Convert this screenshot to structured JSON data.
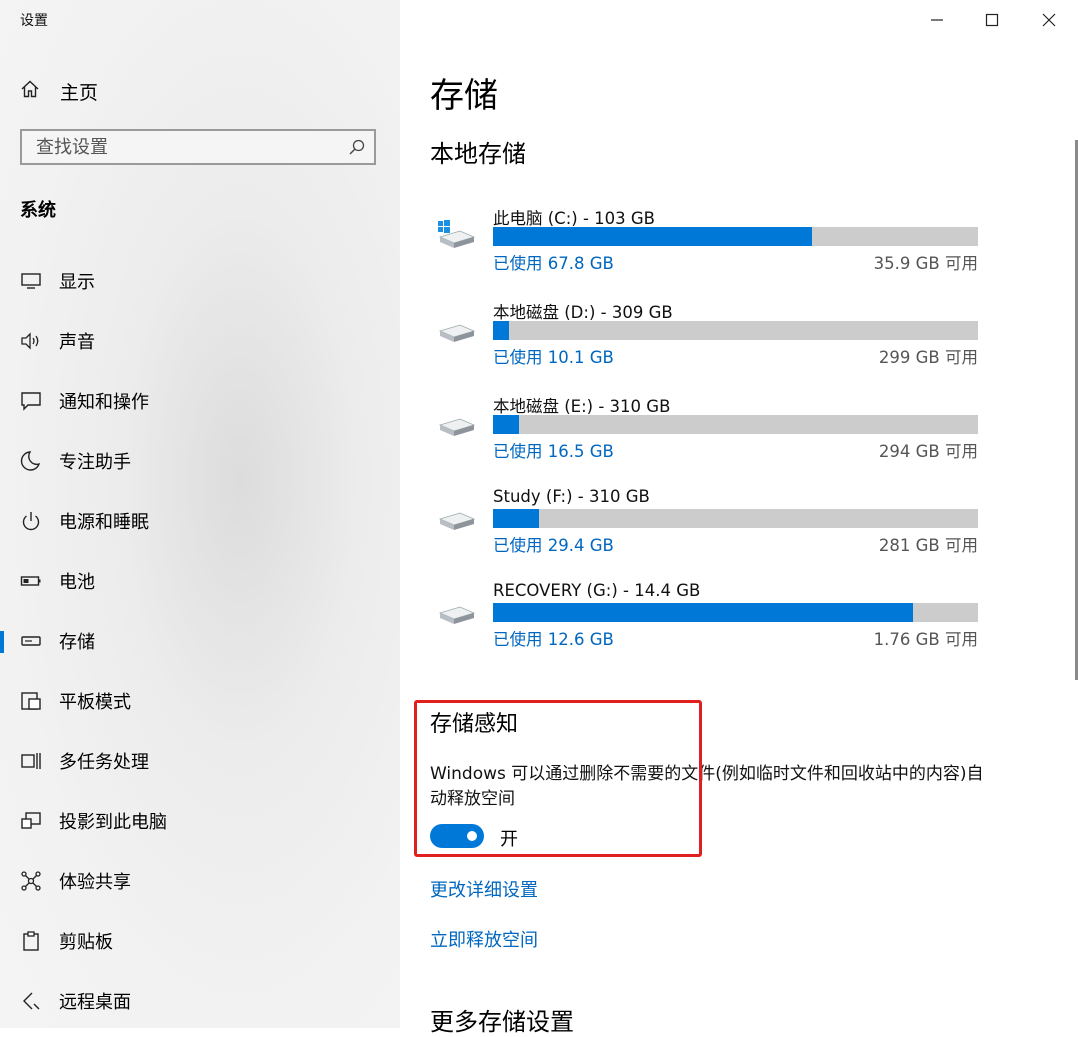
{
  "window": {
    "title": "设置"
  },
  "sidebar": {
    "home_label": "主页",
    "search_placeholder": "查找设置",
    "section_title": "系统",
    "items": [
      {
        "label": "显示",
        "icon": "display-icon"
      },
      {
        "label": "声音",
        "icon": "speaker-icon"
      },
      {
        "label": "通知和操作",
        "icon": "notification-icon"
      },
      {
        "label": "专注助手",
        "icon": "moon-icon"
      },
      {
        "label": "电源和睡眠",
        "icon": "power-icon"
      },
      {
        "label": "电池",
        "icon": "battery-icon"
      },
      {
        "label": "存储",
        "icon": "storage-icon",
        "active": true
      },
      {
        "label": "平板模式",
        "icon": "tablet-mode-icon"
      },
      {
        "label": "多任务处理",
        "icon": "multitasking-icon"
      },
      {
        "label": "投影到此电脑",
        "icon": "projecting-icon"
      },
      {
        "label": "体验共享",
        "icon": "share-icon"
      },
      {
        "label": "剪贴板",
        "icon": "clipboard-icon"
      },
      {
        "label": "远程桌面",
        "icon": "remote-desktop-icon"
      }
    ]
  },
  "main": {
    "title": "存储",
    "local_storage_title": "本地存储",
    "drives": [
      {
        "name": "此电脑 (C:) - 103 GB",
        "used": "已使用 67.8 GB",
        "free": "35.9 GB 可用",
        "used_fraction": 0.658,
        "icon": "windows-drive-icon"
      },
      {
        "name": "本地磁盘 (D:) - 309 GB",
        "used": "已使用 10.1 GB",
        "free": "299 GB 可用",
        "used_fraction": 0.033,
        "icon": "drive-icon"
      },
      {
        "name": "本地磁盘 (E:) - 310 GB",
        "used": "已使用 16.5 GB",
        "free": "294 GB 可用",
        "used_fraction": 0.053,
        "icon": "drive-icon"
      },
      {
        "name": "Study (F:) - 310 GB",
        "used": "已使用 29.4 GB",
        "free": "281 GB 可用",
        "used_fraction": 0.095,
        "icon": "drive-icon"
      },
      {
        "name": "RECOVERY (G:) - 14.4 GB",
        "used": "已使用 12.6 GB",
        "free": "1.76 GB 可用",
        "used_fraction": 0.867,
        "icon": "drive-icon"
      }
    ],
    "storage_sense": {
      "title": "存储感知",
      "description": "Windows 可以通过删除不需要的文件(例如临时文件和回收站中的内容)自动释放空间",
      "toggle_state": "开",
      "toggle_on": true
    },
    "links": {
      "change_settings": "更改详细设置",
      "free_space_now": "立即释放空间"
    },
    "more_title": "更多存储设置"
  },
  "colors": {
    "accent": "#0078d7",
    "link": "#0067c0",
    "highlight_box": "#e0201e"
  }
}
